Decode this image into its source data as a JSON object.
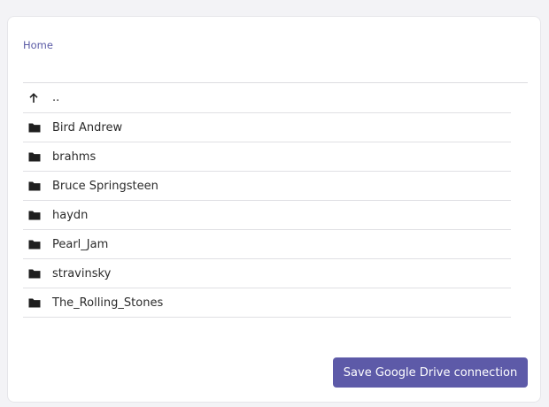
{
  "breadcrumb": {
    "home": "Home"
  },
  "list": {
    "parent": {
      "label": "..",
      "icon": "arrow-up-icon"
    },
    "folders": [
      {
        "label": "Bird Andrew",
        "icon": "folder-icon"
      },
      {
        "label": "brahms",
        "icon": "folder-icon"
      },
      {
        "label": "Bruce Springsteen",
        "icon": "folder-icon"
      },
      {
        "label": "haydn",
        "icon": "folder-icon"
      },
      {
        "label": "Pearl_Jam",
        "icon": "folder-icon"
      },
      {
        "label": "stravinsky",
        "icon": "folder-icon"
      },
      {
        "label": "The_Rolling_Stones",
        "icon": "folder-icon"
      }
    ]
  },
  "actions": {
    "save_label": "Save Google Drive connection"
  },
  "colors": {
    "accent": "#5d5aa8",
    "link": "#5b5ba6"
  }
}
